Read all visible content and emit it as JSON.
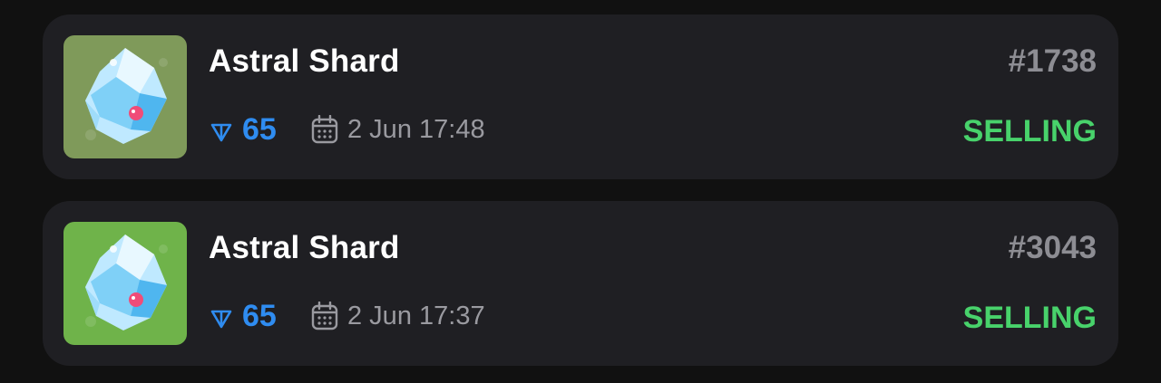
{
  "items": [
    {
      "name": "Astral Shard",
      "number": "#1738",
      "price": "65",
      "date": "2 Jun 17:48",
      "status": "SELLING",
      "thumb_bg": "#7f9a5a"
    },
    {
      "name": "Astral Shard",
      "number": "#3043",
      "price": "65",
      "date": "2 Jun 17:37",
      "status": "SELLING",
      "thumb_bg": "#6fb34a"
    }
  ],
  "icons": {
    "price": "ton-diamond-icon",
    "date": "calendar-icon",
    "thumbnail": "crystal-shard-icon"
  },
  "colors": {
    "page_bg": "#111111",
    "card_bg": "#1f1f23",
    "title": "#ffffff",
    "number": "#8d8d93",
    "price": "#2f8cf0",
    "date": "#9a9aa0",
    "status_selling": "#48d26b"
  }
}
